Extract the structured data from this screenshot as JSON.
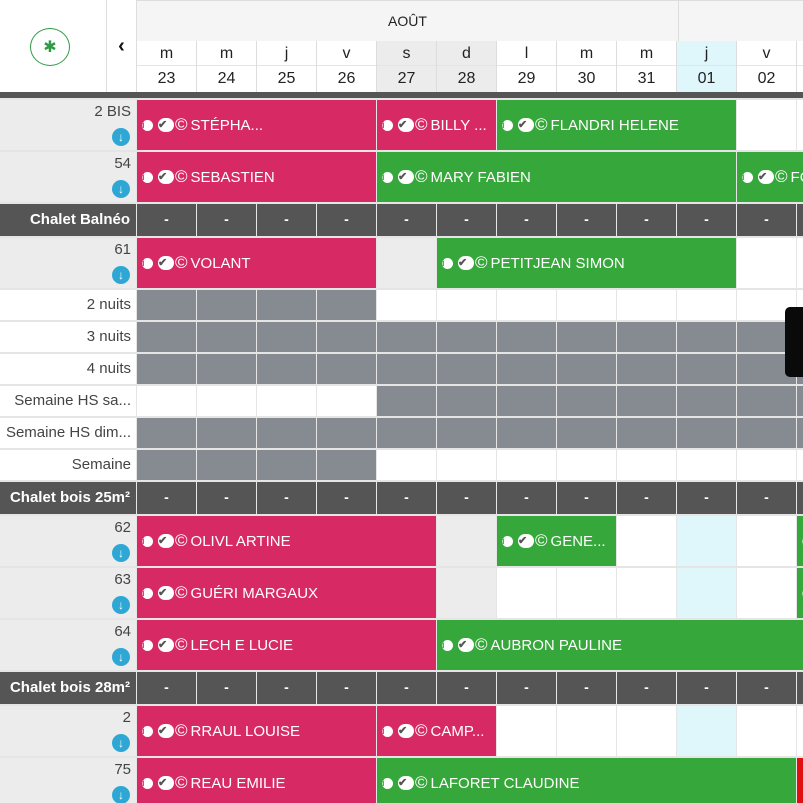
{
  "header": {
    "settings_icon": "gear-icon",
    "prev_label": "‹",
    "month": "AOÛT",
    "days": [
      {
        "letter": "m",
        "num": "23",
        "type": "normal"
      },
      {
        "letter": "m",
        "num": "24",
        "type": "normal"
      },
      {
        "letter": "j",
        "num": "25",
        "type": "normal"
      },
      {
        "letter": "v",
        "num": "26",
        "type": "normal"
      },
      {
        "letter": "s",
        "num": "27",
        "type": "weekend"
      },
      {
        "letter": "d",
        "num": "28",
        "type": "weekend"
      },
      {
        "letter": "l",
        "num": "29",
        "type": "normal"
      },
      {
        "letter": "m",
        "num": "30",
        "type": "normal"
      },
      {
        "letter": "m",
        "num": "31",
        "type": "normal"
      },
      {
        "letter": "j",
        "num": "01",
        "type": "today"
      },
      {
        "letter": "v",
        "num": "02",
        "type": "normal"
      }
    ]
  },
  "icons": {
    "info": "i",
    "check": "✔",
    "copyright": "©",
    "download": "↓"
  },
  "rows": [
    {
      "kind": "unit",
      "label": "2 BIS",
      "bookings": [
        {
          "name": "STÉPHA...",
          "color": "pink",
          "start": 0,
          "span": 4
        },
        {
          "name": "BILLY ...",
          "color": "pink",
          "start": 4,
          "span": 2
        },
        {
          "name": "FLANDRI   HELENE",
          "color": "green",
          "start": 6,
          "span": 4
        }
      ]
    },
    {
      "kind": "unit",
      "label": "54",
      "bookings": [
        {
          "name": "SEBASTIEN",
          "color": "pink",
          "start": 0,
          "span": 4
        },
        {
          "name": "MARY FABIEN",
          "color": "green",
          "start": 4,
          "span": 6
        },
        {
          "name": "FO",
          "color": "green",
          "start": 10,
          "span": 2
        }
      ]
    },
    {
      "kind": "group",
      "label": "Chalet Balnéo",
      "dash": "-"
    },
    {
      "kind": "unit",
      "label": "61",
      "bookings": [
        {
          "name": "VOLANT",
          "color": "pink",
          "start": 0,
          "span": 4
        },
        {
          "name": "PETITJEAN SIMON",
          "color": "green",
          "start": 5,
          "span": 5
        }
      ]
    },
    {
      "kind": "rule",
      "label": "2 nuits",
      "closed": [
        0,
        1,
        2,
        3
      ]
    },
    {
      "kind": "rule",
      "label": "3 nuits",
      "closed": [
        0,
        1,
        2,
        3,
        4,
        5,
        6,
        7,
        8,
        9,
        10,
        11
      ]
    },
    {
      "kind": "rule",
      "label": "4 nuits",
      "closed": [
        0,
        1,
        2,
        3,
        4,
        5,
        6,
        7,
        8,
        9,
        10,
        11
      ]
    },
    {
      "kind": "rule",
      "label": "Semaine HS sa...",
      "closed": [
        4,
        5,
        6,
        7,
        8,
        9,
        10,
        11
      ]
    },
    {
      "kind": "rule",
      "label": "Semaine HS dim...",
      "closed": [
        0,
        1,
        2,
        3,
        4,
        5,
        6,
        7,
        8,
        9,
        10,
        11
      ]
    },
    {
      "kind": "rule",
      "label": "Semaine",
      "closed": [
        0,
        1,
        2,
        3
      ]
    },
    {
      "kind": "group",
      "label": "Chalet bois 25m²",
      "dash": "-"
    },
    {
      "kind": "unit",
      "label": "62",
      "bookings": [
        {
          "name": "OLIVL      ARTINE",
          "color": "pink",
          "start": 0,
          "span": 5
        },
        {
          "name": "GENE...",
          "color": "green",
          "start": 6,
          "span": 2
        },
        {
          "name": "",
          "color": "green",
          "start": 11,
          "span": 1
        }
      ]
    },
    {
      "kind": "unit",
      "label": "63",
      "bookings": [
        {
          "name": "GUÉRI  MARGAUX",
          "color": "pink",
          "start": 0,
          "span": 5
        },
        {
          "name": "",
          "color": "green",
          "start": 11,
          "span": 1
        }
      ]
    },
    {
      "kind": "unit",
      "label": "64",
      "bookings": [
        {
          "name": "LECH    E LUCIE",
          "color": "pink",
          "start": 0,
          "span": 5
        },
        {
          "name": "AUBRON PAULINE",
          "color": "green",
          "start": 5,
          "span": 7
        }
      ]
    },
    {
      "kind": "group",
      "label": "Chalet bois 28m²",
      "dash": "-"
    },
    {
      "kind": "unit",
      "label": "2",
      "bookings": [
        {
          "name": "RRAUL  LOUISE",
          "color": "pink",
          "start": 0,
          "span": 4
        },
        {
          "name": "CAMP...",
          "color": "pink",
          "start": 4,
          "span": 2
        }
      ]
    },
    {
      "kind": "unit",
      "label": "75",
      "bookings": [
        {
          "name": "REAU EMILIE",
          "color": "pink",
          "start": 0,
          "span": 4
        },
        {
          "name": "LAFORET CLAUDINE",
          "color": "green",
          "start": 4,
          "span": 7
        },
        {
          "name": "",
          "color": "red",
          "start": 11,
          "span": 1
        }
      ]
    }
  ]
}
